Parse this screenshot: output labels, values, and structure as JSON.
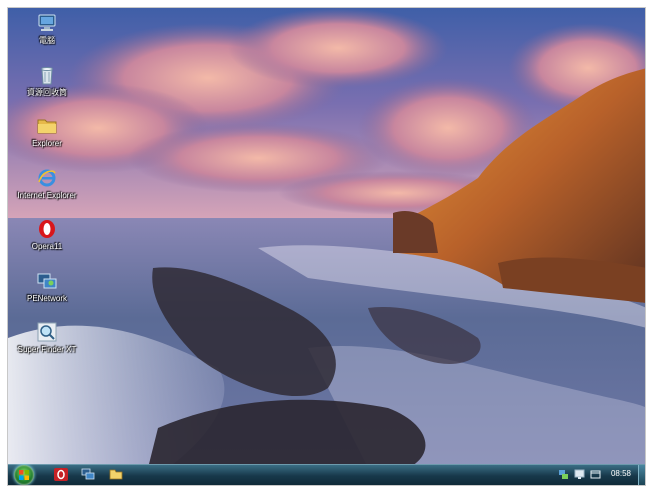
{
  "desktop_icons": [
    {
      "label": "電腦",
      "icon": "computer-icon"
    },
    {
      "label": "資源回收筒",
      "icon": "recycle-bin-icon"
    },
    {
      "label": "Explorer",
      "icon": "folder-icon"
    },
    {
      "label": "Internet Explorer",
      "icon": "internet-explorer-icon"
    },
    {
      "label": "Opera11",
      "icon": "opera-icon"
    },
    {
      "label": "PENetwork",
      "icon": "network-icon"
    },
    {
      "label": "Super Finder XT",
      "icon": "magnifier-search-icon"
    }
  ],
  "taskbar": {
    "pinned": [
      "opera-icon",
      "network-icon",
      "explorer-folder-icon"
    ],
    "tray": [
      "network-tray-icon",
      "display-tray-icon",
      "window-tray-icon"
    ],
    "clock": "08:58"
  },
  "colors": {
    "taskbar_top": "#3a6e85",
    "taskbar_bottom": "#0f2a38",
    "sky_top": "#3f5fa8",
    "sea": "#5b6b96"
  }
}
